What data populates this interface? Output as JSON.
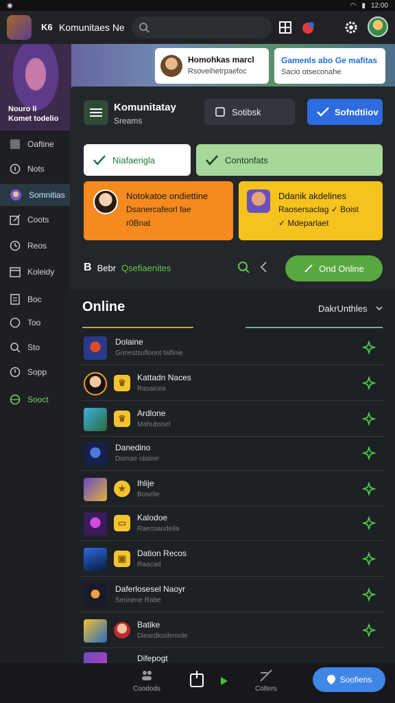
{
  "statusbar": {
    "time": "12:00"
  },
  "appbar": {
    "tag": "K6",
    "title": "Komunitaes Ne"
  },
  "hero": {
    "label_line1": "Nouro li",
    "label_line2": "Komet todelio"
  },
  "notifications": [
    {
      "title": "Homohkas marcl",
      "subtitle": "Rsoveihetrpaefoc"
    },
    {
      "title": "Gamenls abo Ge mafitas",
      "subtitle": "Sacio otseconahe"
    }
  ],
  "sidebar": {
    "items": [
      {
        "label": "Oaftine",
        "icon": "square-icon"
      },
      {
        "label": "Nots",
        "icon": "info-icon"
      },
      {
        "label": "Somnitias",
        "icon": "avatar-icon",
        "active": true
      },
      {
        "label": "Coots",
        "icon": "edit-icon"
      },
      {
        "label": "Reos",
        "icon": "clock-icon"
      },
      {
        "label": "Koleidy",
        "icon": "calendar-icon"
      },
      {
        "label": "Boc",
        "icon": "document-icon"
      },
      {
        "label": "Too",
        "icon": "circle-icon"
      },
      {
        "label": "Sto",
        "icon": "search-icon"
      },
      {
        "label": "Sopp",
        "icon": "info-circle-icon"
      },
      {
        "label": "Sooct",
        "icon": "globe-icon",
        "green": true
      }
    ]
  },
  "panel": {
    "community_title": "Komunitatay",
    "community_sub": "Sreams",
    "sort_label": "Sotibsk",
    "solid_label": "Sofndtiiov",
    "chip_white_label": "Niafaerigla",
    "chip_green_label": "Contonfats",
    "card_orange": {
      "l1": "Notokatoe ondiettine",
      "l2": "Dsanercafeorl fae",
      "l3": "r0Bnat"
    },
    "card_yellow": {
      "l1": "Ddanik akdelines",
      "l2": "Raosersaclag ✓ Boist",
      "l3": "✓ Mdeparlaet"
    },
    "search_prefix": "B",
    "search_word": "Bebr",
    "search_green": "Qsefiaenites",
    "online_button": "Ond Online",
    "online_heading": "Online",
    "filter_label": "DakrUnthles"
  },
  "rows": [
    {
      "name": "Dolaine",
      "sub": "Gonestsufloont talfinie",
      "thumb": "red-hero"
    },
    {
      "name": "Kattadn Naces",
      "sub": "Rasaicea",
      "thumb": "portrait",
      "badge": "gold"
    },
    {
      "name": "Ardlone",
      "sub": "Mahubssel",
      "thumb": "green-blue",
      "badge": "gold"
    },
    {
      "name": "Danedino",
      "sub": "Domae olaleie",
      "thumb": "blue-hero"
    },
    {
      "name": "Ihlije",
      "sub": "Boselie",
      "thumb": "purple-gold",
      "badge": "gold-round"
    },
    {
      "name": "Kalodoe",
      "sub": "Raecoaudeila",
      "thumb": "purple-hero",
      "badge": "gold"
    },
    {
      "name": "Dation Recos",
      "sub": "Raacad",
      "thumb": "blue-sign",
      "badge": "gold"
    },
    {
      "name": "Daferlosesel Naoyr",
      "sub": "Serinene Rabe",
      "thumb": "dark-hero"
    },
    {
      "name": "Batike",
      "sub": "Dieardlosilemole",
      "thumb": "yellow-blue",
      "badge": "face"
    },
    {
      "name": "Difepogt",
      "sub": "",
      "thumb": "purple-small"
    }
  ],
  "bottomnav": {
    "items": [
      {
        "label": "Coodods"
      },
      {
        "label": ""
      },
      {
        "label": ""
      },
      {
        "label": "Colters"
      }
    ],
    "fab_label": "Soofiens"
  },
  "colors": {
    "accent_green": "#58a83f",
    "accent_blue": "#2d6be0",
    "orange": "#f58a1e",
    "yellow": "#f5c21e"
  }
}
